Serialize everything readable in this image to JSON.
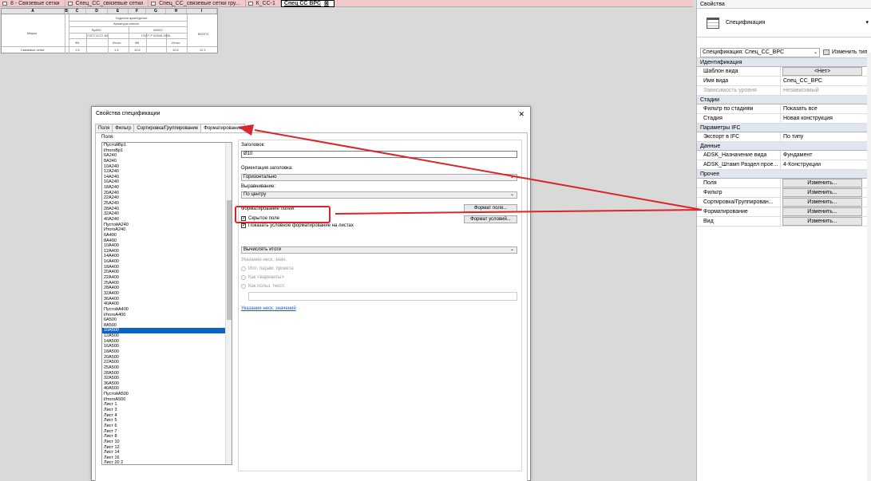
{
  "tabs": [
    {
      "label": "8 - Связевые сетки",
      "active": false
    },
    {
      "label": "Спец_СС_связевые сетки",
      "active": false
    },
    {
      "label": "Спец_СС_связевые сетки гру...",
      "active": false
    },
    {
      "label": "К_СС-1",
      "active": false
    },
    {
      "label": "Спец СС ВРС",
      "active": true
    }
  ],
  "sheet": {
    "columns": [
      "A",
      "B",
      "C",
      "D",
      "E",
      "F",
      "G",
      "H",
      "I"
    ],
    "header_row1": "Изделия арматурные",
    "header_row2": "Арматура класса",
    "grade1": "Вр500",
    "grade2": "А500С",
    "std1": "ГОСТ 6727-80",
    "std2": "ГОСТ Р 52544-2006",
    "mark": "Марка",
    "d1": "Ф5",
    "total1": "Итого",
    "d2": "Ф8",
    "total2": "Итого",
    "total_all": "ВСЕГО",
    "row_label": "Связевые сетки",
    "v1": "1,5",
    "v2": "1,5",
    "v3": "10,6",
    "v4": "10,6",
    "v5": "12,1"
  },
  "properties": {
    "title": "Свойства",
    "type_name": "Спецификация",
    "selector": "Спецификация: Спец_СС_ВРС",
    "edit_type": "Изменить тип",
    "groups": [
      {
        "name": "Идентификация",
        "rows": [
          {
            "key": "Шаблон вида",
            "value": "<Нет>",
            "button": true,
            "gray": false
          },
          {
            "key": "Имя вида",
            "value": "Спец_СС_ВРС",
            "button": false,
            "gray": false
          },
          {
            "key": "Зависимость уровня",
            "value": "Независимый",
            "button": false,
            "gray": true
          }
        ]
      },
      {
        "name": "Стадии",
        "rows": [
          {
            "key": "Фильтр по стадиям",
            "value": "Показать все",
            "button": false,
            "gray": false
          },
          {
            "key": "Стадия",
            "value": "Новая конструкция",
            "button": false,
            "gray": false
          }
        ]
      },
      {
        "name": "Параметры IFC",
        "rows": [
          {
            "key": "Экспорт в IFC",
            "value": "По типу",
            "button": false,
            "gray": false
          }
        ]
      },
      {
        "name": "Данные",
        "rows": [
          {
            "key": "ADSK_Назначение вида",
            "value": "Фундамент",
            "button": false,
            "gray": false
          },
          {
            "key": "ADSK_Штамп Раздел прое...",
            "value": "4-Конструкции",
            "button": false,
            "gray": false
          }
        ]
      },
      {
        "name": "Прочее",
        "rows": [
          {
            "key": "Поля",
            "value": "Изменить...",
            "button": true,
            "gray": false
          },
          {
            "key": "Фильтр",
            "value": "Изменить...",
            "button": true,
            "gray": false
          },
          {
            "key": "Сортировка/Группирован...",
            "value": "Изменить...",
            "button": true,
            "gray": false
          },
          {
            "key": "Форматирование",
            "value": "Изменить...",
            "button": true,
            "gray": false
          },
          {
            "key": "Вид",
            "value": "Изменить...",
            "button": true,
            "gray": false
          }
        ]
      }
    ]
  },
  "dialog": {
    "title": "Свойства спецификации",
    "tabs": [
      "Поля",
      "Фильтр",
      "Сортировка/Группирование",
      "Форматирование"
    ],
    "active_tab": "Форматирование",
    "fields_label": "Поля:",
    "fields": [
      "ПустойВр1",
      "ИтогоВр1",
      "6А240",
      "8А240",
      "10А240",
      "12А240",
      "14А240",
      "16А240",
      "18А240",
      "20А240",
      "22А240",
      "25А240",
      "28А240",
      "32А240",
      "40А240",
      "ПустойА240",
      "ИтогоА240",
      "6А400",
      "8А400",
      "10А400",
      "12А400",
      "14А400",
      "16А400",
      "18А400",
      "20А400",
      "22А400",
      "25А400",
      "28А400",
      "32А400",
      "36А400",
      "40А400",
      "ПустойА400",
      "ИтогоА400",
      "6А500",
      "8А500",
      "10А500",
      "12А500",
      "14А500",
      "16А500",
      "18А500",
      "20А500",
      "22А500",
      "25А500",
      "28А500",
      "32А500",
      "36А500",
      "40А500",
      "ПустойА500",
      "ИтогоА500",
      "Лист 1",
      "Лист 3",
      "Лист 4",
      "Лист 5",
      "Лист 6",
      "Лист 7",
      "Лист 8",
      "Лист 10",
      "Лист 12",
      "Лист 14",
      "Лист 16",
      "Лист 20 2"
    ],
    "selected_field": "10А500",
    "heading_label": "Заголовок:",
    "heading_value": "Ø10",
    "orientation_label": "Ориентация заголовка:",
    "orientation_value": "Горизонтально",
    "alignment_label": "Выравнивание:",
    "alignment_value": "По центру",
    "field_format_label": "Форматирование полей:",
    "field_format_button": "Формат поля...",
    "conditional_format_button": "Формат условий...",
    "hidden_field_label": "Скрытое поле",
    "show_conditional_label": "Показать условное форматирование на листах",
    "calc_totals_value": "Вычислять итоги",
    "multiple_values_label": "Указание неск. знач.",
    "radio1": "Исп. парам. проекта",
    "radio2": "Как <варианты>",
    "radio3": "Как польз. текст:",
    "link_label": "Указание неск. значений"
  },
  "colors": {
    "tabbar": "#f2c9c9",
    "annotation_red": "#d9252b",
    "selection_blue": "#0a64c8",
    "group_header": "#dfe6ef"
  }
}
